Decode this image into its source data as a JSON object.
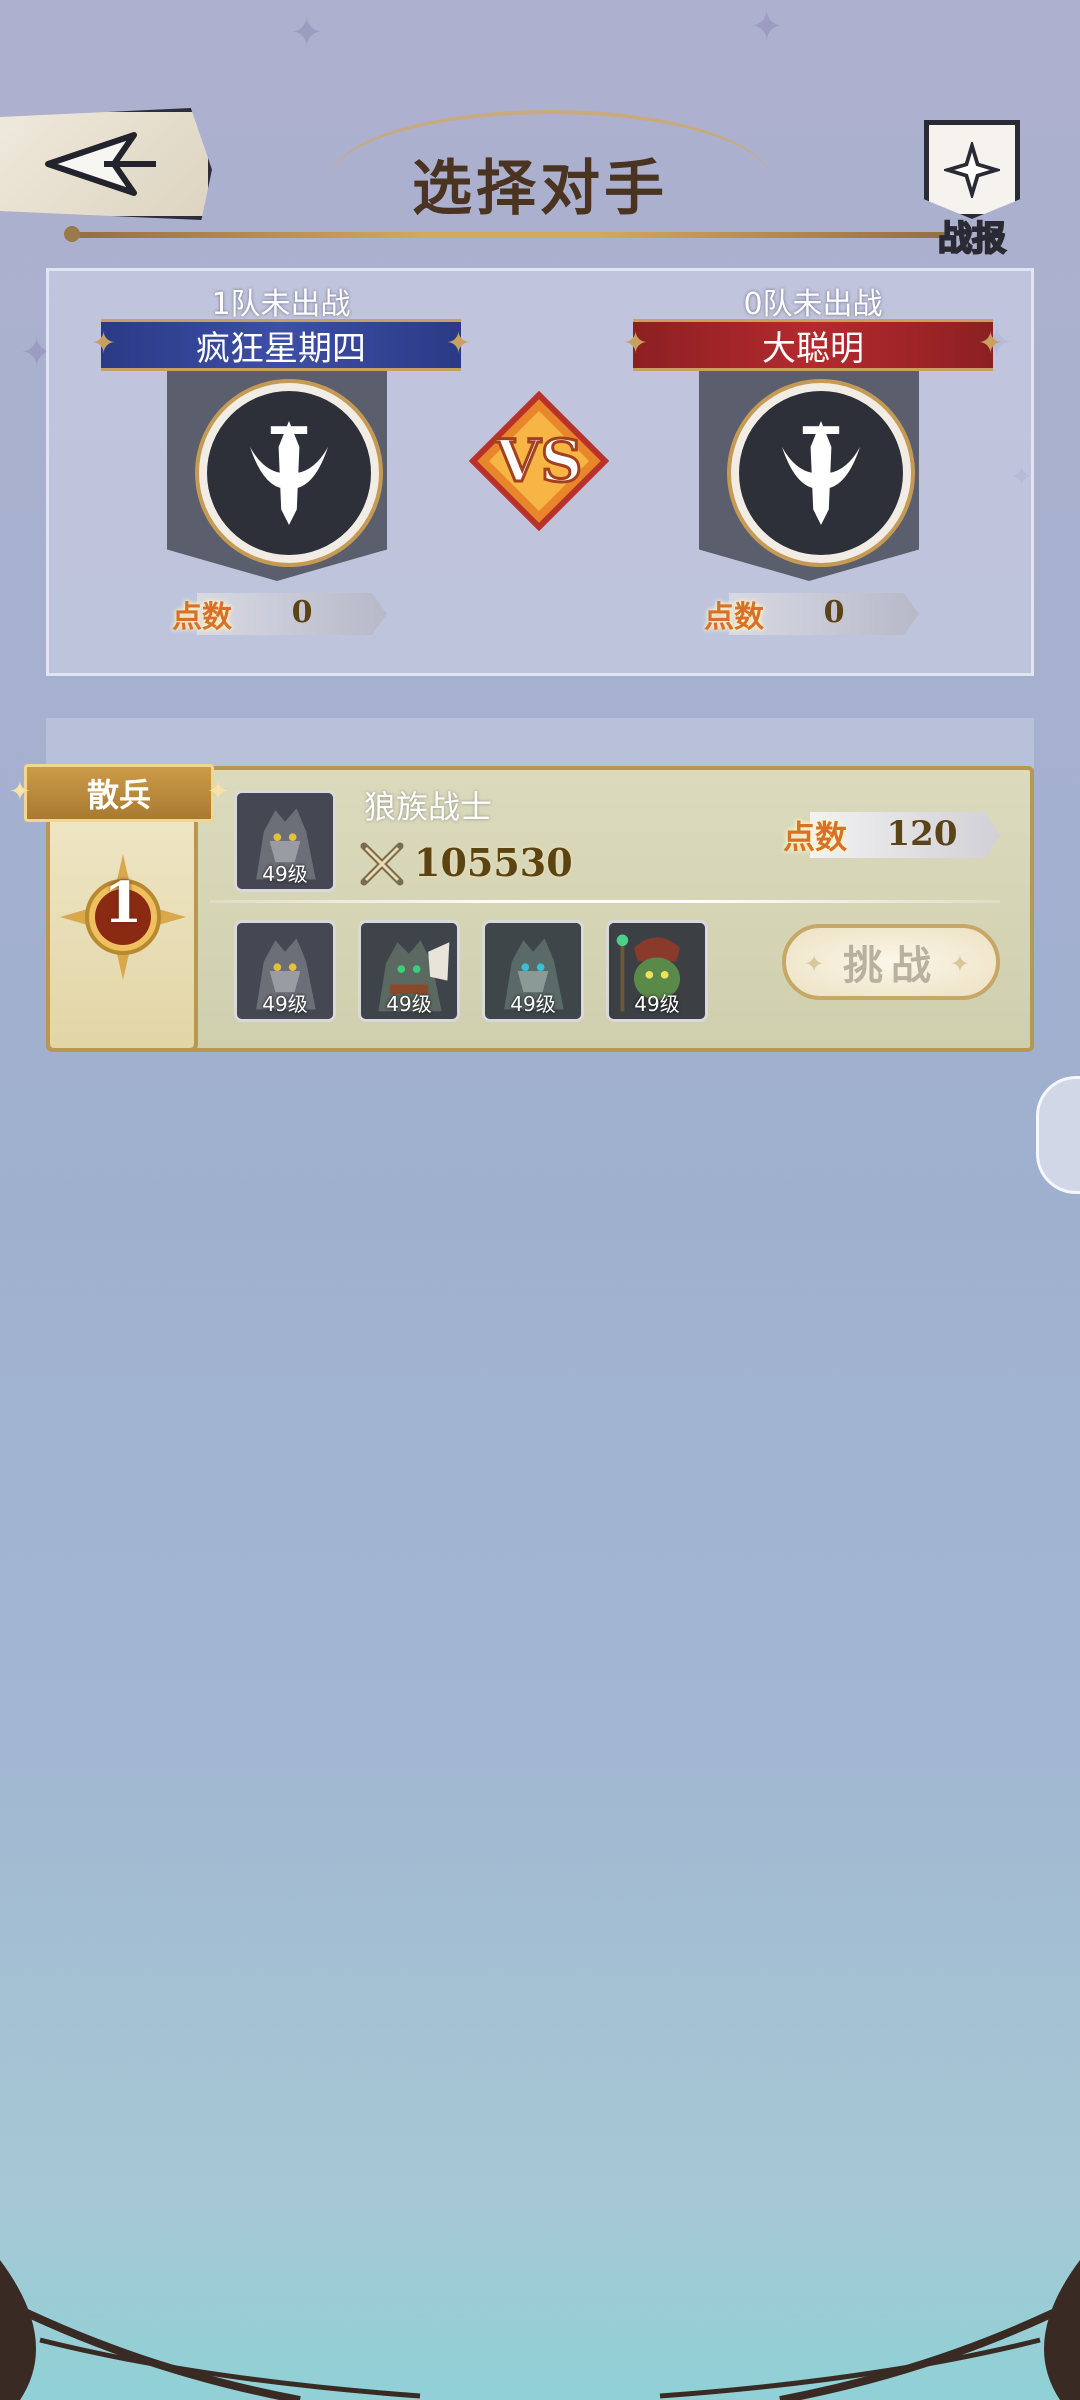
{
  "header": {
    "title": "选择对手",
    "back_icon": "back-arrow-icon",
    "battle_report_label": "战报"
  },
  "teams": {
    "left": {
      "status": "1队未出战",
      "name": "疯狂星期四",
      "points_label": "点数",
      "points": "0",
      "banner_color": "#34449a"
    },
    "right": {
      "status": "0队未出战",
      "name": "大聪明",
      "points_label": "点数",
      "points": "0",
      "banner_color": "#a8282c"
    }
  },
  "opponents": [
    {
      "rank_tag": "散兵",
      "rank": "1",
      "name": "狼族战士",
      "power": "105530",
      "points_label": "点数",
      "points": "120",
      "leader_level": "49级",
      "units": [
        {
          "level": "49级",
          "icon": "wolf-warrior-portrait"
        },
        {
          "level": "49级",
          "icon": "wolf-shaman-portrait"
        },
        {
          "level": "49级",
          "icon": "wolf-warrior-portrait"
        },
        {
          "level": "49级",
          "icon": "goblin-mage-portrait"
        }
      ],
      "challenge_label": "挑战"
    }
  ],
  "colors": {
    "gold": "#b8984f",
    "points_orange": "#d9702a"
  }
}
